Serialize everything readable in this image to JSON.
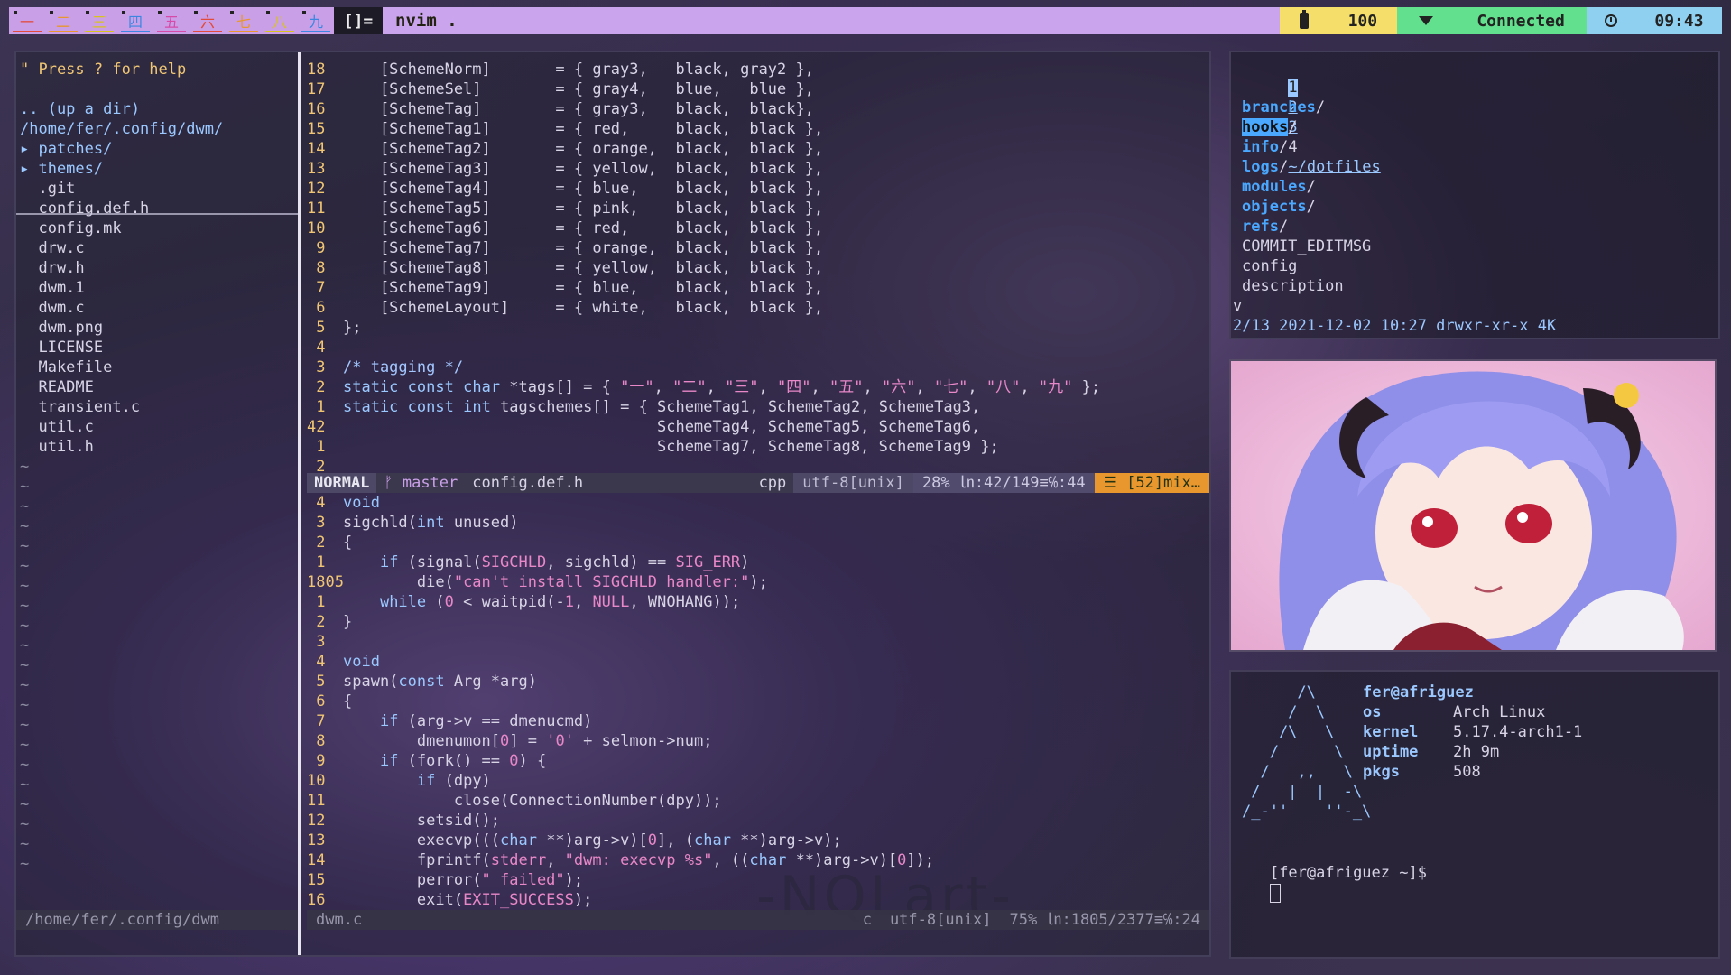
{
  "topbar": {
    "tags": [
      {
        "label": "一",
        "color": "#e24a3a"
      },
      {
        "label": "二",
        "color": "#e8962e"
      },
      {
        "label": "三",
        "color": "#d8c21e"
      },
      {
        "label": "四",
        "color": "#3a86e0"
      },
      {
        "label": "五",
        "color": "#d64aa8"
      },
      {
        "label": "六",
        "color": "#e24a3a"
      },
      {
        "label": "七",
        "color": "#e8962e"
      },
      {
        "label": "八",
        "color": "#d8c21e"
      },
      {
        "label": "九",
        "color": "#3a86e0"
      }
    ],
    "layout": "[]=",
    "window_title": "nvim .",
    "battery": "100",
    "wifi": "Connected",
    "clock": "09:43",
    "icons": {
      "battery": "battery-icon",
      "wifi": "wifi-icon",
      "clock": "clock-icon"
    }
  },
  "nvimtree": {
    "help": "\" Press ? for help",
    "up": ".. (up a dir)",
    "path": "/home/fer/.config/dwm/",
    "dirs": [
      "▸ patches/",
      "▸ themes/"
    ],
    "files": [
      ".git",
      "config.def.h",
      "config.mk",
      "drw.c",
      "drw.h",
      "dwm.1",
      "dwm.c",
      "dwm.png",
      "LICENSE",
      "Makefile",
      "README",
      "transient.c",
      "util.c",
      "util.h"
    ],
    "status": "/home/fer/.config/dwm"
  },
  "buffer1": {
    "lines": [
      {
        "n": "18",
        "t": "    [SchemeNorm]       = { gray3,   black, gray2 },"
      },
      {
        "n": "17",
        "t": "    [SchemeSel]        = { gray4,   blue,   blue },"
      },
      {
        "n": "16",
        "t": "    [SchemeTag]        = { gray3,   black,  black},"
      },
      {
        "n": "15",
        "t": "    [SchemeTag1]       = { red,     black,  black },"
      },
      {
        "n": "14",
        "t": "    [SchemeTag2]       = { orange,  black,  black },"
      },
      {
        "n": "13",
        "t": "    [SchemeTag3]       = { yellow,  black,  black },"
      },
      {
        "n": "12",
        "t": "    [SchemeTag4]       = { blue,    black,  black },"
      },
      {
        "n": "11",
        "t": "    [SchemeTag5]       = { pink,    black,  black },"
      },
      {
        "n": "10",
        "t": "    [SchemeTag6]       = { red,     black,  black },"
      },
      {
        "n": " 9",
        "t": "    [SchemeTag7]       = { orange,  black,  black },"
      },
      {
        "n": " 8",
        "t": "    [SchemeTag8]       = { yellow,  black,  black },"
      },
      {
        "n": " 7",
        "t": "    [SchemeTag9]       = { blue,    black,  black },"
      },
      {
        "n": " 6",
        "t": "    [SchemeLayout]     = { white,   black,  black },"
      },
      {
        "n": " 5",
        "t": "};"
      },
      {
        "n": " 4",
        "t": ""
      },
      {
        "n": " 3",
        "t": "/* tagging */"
      },
      {
        "n": " 2",
        "t": "static const char *tags[] = { \"一\", \"二\", \"三\", \"四\", \"五\", \"六\", \"七\", \"八\", \"九\" };"
      },
      {
        "n": " 1",
        "t": "static const int tagschemes[] = { SchemeTag1, SchemeTag2, SchemeTag3,"
      },
      {
        "n": "42",
        "t": "                                  SchemeTag4, SchemeTag5, SchemeTag6,"
      },
      {
        "n": " 1",
        "t": "                                  SchemeTag7, SchemeTag8, SchemeTag9 };"
      },
      {
        "n": " 2",
        "t": ""
      }
    ],
    "status": {
      "mode": "NORMAL",
      "branch": "ᚠ master",
      "file": "config.def.h",
      "filetype": "cpp",
      "encoding": "utf-8[unix]",
      "position": "28% ㏑:42/149≡℅:44",
      "warning": "☰ [52]mix…"
    }
  },
  "buffer2": {
    "lines": [
      {
        "n": " 4",
        "t": "void"
      },
      {
        "n": " 3",
        "t": "sigchld(int unused)"
      },
      {
        "n": " 2",
        "t": "{"
      },
      {
        "n": " 1",
        "t": "    if (signal(SIGCHLD, sigchld) == SIG_ERR)"
      },
      {
        "n": "1805",
        "t": "        die(\"can't install SIGCHLD handler:\");"
      },
      {
        "n": " 1",
        "t": "    while (0 < waitpid(-1, NULL, WNOHANG));"
      },
      {
        "n": " 2",
        "t": "}"
      },
      {
        "n": " 3",
        "t": ""
      },
      {
        "n": " 4",
        "t": "void"
      },
      {
        "n": " 5",
        "t": "spawn(const Arg *arg)"
      },
      {
        "n": " 6",
        "t": "{"
      },
      {
        "n": " 7",
        "t": "    if (arg->v == dmenucmd)"
      },
      {
        "n": " 8",
        "t": "        dmenumon[0] = '0' + selmon->num;"
      },
      {
        "n": " 9",
        "t": "    if (fork() == 0) {"
      },
      {
        "n": "10",
        "t": "        if (dpy)"
      },
      {
        "n": "11",
        "t": "            close(ConnectionNumber(dpy));"
      },
      {
        "n": "12",
        "t": "        setsid();"
      },
      {
        "n": "13",
        "t": "        execvp(((char **)arg->v)[0], (char **)arg->v);"
      },
      {
        "n": "14",
        "t": "        fprintf(stderr, \"dwm: execvp %s\", ((char **)arg->v)[0]);"
      },
      {
        "n": "15",
        "t": "        perror(\" failed\");"
      },
      {
        "n": "16",
        "t": "        exit(EXIT_SUCCESS);"
      }
    ],
    "status": {
      "file": "dwm.c",
      "filetype": "c",
      "encoding": "utf-8[unix]",
      "position": "75% ㏑:1805/2377≡℅:24"
    }
  },
  "watermark": "-NQLart-",
  "ranger": {
    "tabs": [
      "1",
      "2",
      "3",
      "4"
    ],
    "path": "~/dotfiles",
    "dirs": [
      "branches",
      "hooks",
      "info",
      "logs",
      "modules",
      "objects",
      "refs"
    ],
    "files": [
      "COMMIT_EDITMSG",
      "config",
      "description"
    ],
    "more": "v",
    "statusline": "2/13 2021-12-02 10:27 drwxr-xr-x 4K"
  },
  "fetch": {
    "logo": [
      "      /\\",
      "     /  \\",
      "    /\\   \\",
      "   /      \\",
      "  /   ,,   \\",
      " /   |  |  -\\",
      "/_-''    ''-_\\"
    ],
    "user": "fer@afriguez",
    "info": [
      {
        "k": "os",
        "v": "Arch Linux"
      },
      {
        "k": "kernel",
        "v": "5.17.4-arch1-1"
      },
      {
        "k": "uptime",
        "v": "2h 9m"
      },
      {
        "k": "pkgs",
        "v": "508"
      }
    ],
    "prompt": "[fer@afriguez ~]$"
  }
}
